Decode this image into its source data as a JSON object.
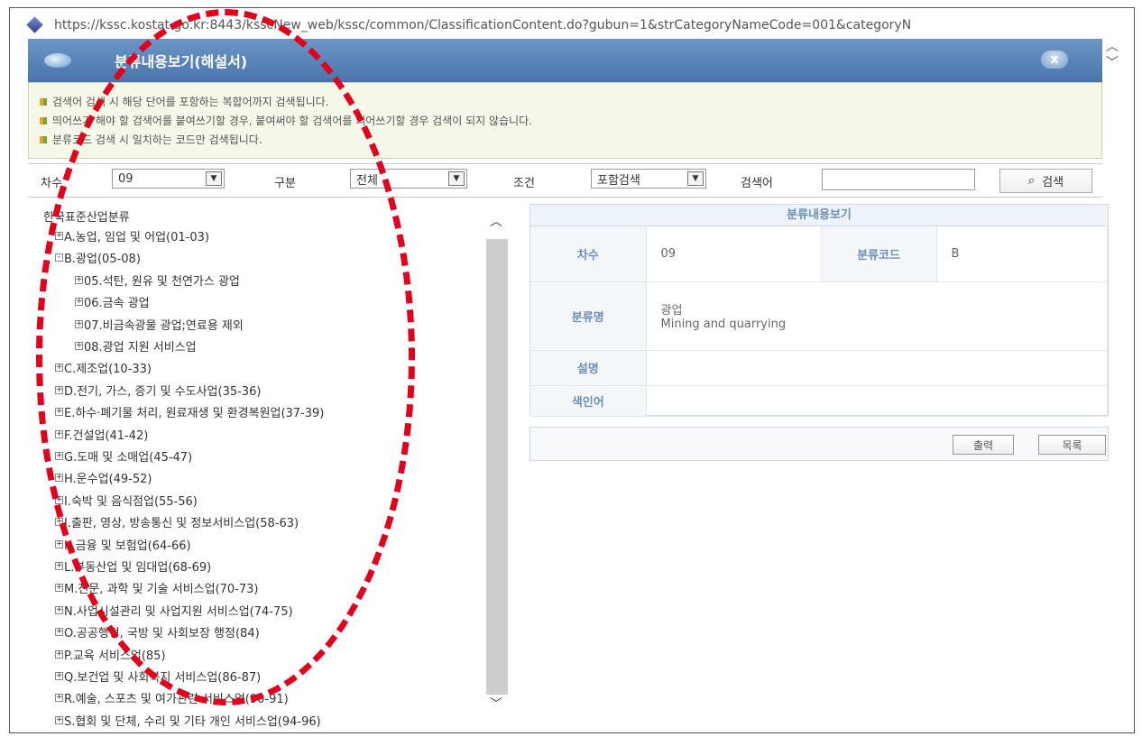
{
  "browser": {
    "url": "https://kssc.kostat.go.kr:8443/ksscNew_web/kssc/common/ClassificationContent.do?gubun=1&strCategoryNameCode=001&categoryN"
  },
  "window": {
    "title": "분류내용보기(해설서)",
    "close_label": "x"
  },
  "notice": {
    "lines": [
      "검색어 검색 시 해당 단어를 포함하는 복합어까지 검색됩니다.",
      "띄어쓰기 해야 할 검색어를 붙여쓰기할 경우, 붙여써야 할 검색어를 띄어쓰기할 경우 검색이 되지 않습니다.",
      "분류코드 검색 시 일치하는 코드만 검색됩니다."
    ]
  },
  "search": {
    "degree_label": "차수",
    "degree_value": "09",
    "division_label": "구분",
    "division_value": "전체",
    "condition_label": "조건",
    "condition_value": "포함검색",
    "keyword_label": "검색어",
    "keyword_value": "",
    "button_label": "검색",
    "icon": "search-icon"
  },
  "tree": {
    "root": "한국표준산업분류",
    "nodes": [
      {
        "label": "A.농업, 임업 및 어업(01-03)",
        "sign": "+",
        "level": 0
      },
      {
        "label": "B.광업(05-08)",
        "sign": "-",
        "level": 0
      },
      {
        "label": "05.석탄, 원유 및 천연가스 광업",
        "sign": "+",
        "level": 1
      },
      {
        "label": "06.금속 광업",
        "sign": "+",
        "level": 1
      },
      {
        "label": "07.비금속광물 광업;연료용 제외",
        "sign": "+",
        "level": 1
      },
      {
        "label": "08.광업 지원 서비스업",
        "sign": "+",
        "level": 1
      },
      {
        "label": "C.제조업(10-33)",
        "sign": "+",
        "level": 0
      },
      {
        "label": "D.전기, 가스, 증기 및 수도사업(35-36)",
        "sign": "+",
        "level": 0
      },
      {
        "label": "E.하수·폐기물 처리, 원료재생 및 환경복원업(37-39)",
        "sign": "+",
        "level": 0
      },
      {
        "label": "F.건설업(41-42)",
        "sign": "+",
        "level": 0
      },
      {
        "label": "G.도매 및 소매업(45-47)",
        "sign": "+",
        "level": 0
      },
      {
        "label": "H.운수업(49-52)",
        "sign": "+",
        "level": 0
      },
      {
        "label": "I.숙박 및 음식점업(55-56)",
        "sign": "+",
        "level": 0
      },
      {
        "label": "J.출판, 영상, 방송통신 및 정보서비스업(58-63)",
        "sign": "+",
        "level": 0
      },
      {
        "label": "K.금융 및 보험업(64-66)",
        "sign": "+",
        "level": 0
      },
      {
        "label": "L.부동산업 및 임대업(68-69)",
        "sign": "+",
        "level": 0
      },
      {
        "label": "M.전문, 과학 및 기술 서비스업(70-73)",
        "sign": "+",
        "level": 0
      },
      {
        "label": "N.사업시설관리 및 사업지원 서비스업(74-75)",
        "sign": "+",
        "level": 0
      },
      {
        "label": "O.공공행정, 국방 및 사회보장 행정(84)",
        "sign": "+",
        "level": 0
      },
      {
        "label": "P.교육 서비스업(85)",
        "sign": "+",
        "level": 0
      },
      {
        "label": "Q.보건업 및 사회복지 서비스업(86-87)",
        "sign": "+",
        "level": 0
      },
      {
        "label": "R.예술, 스포츠 및 여가관련 서비스업(90-91)",
        "sign": "+",
        "level": 0
      },
      {
        "label": "S.협회 및 단체, 수리 및 기타 개인 서비스업(94-96)",
        "sign": "+",
        "level": 0
      }
    ]
  },
  "detail": {
    "header": "분류내용보기",
    "degree_label": "차수",
    "degree_value": "09",
    "code_label": "분류코드",
    "code_value": "B",
    "name_label": "분류명",
    "name_ko": "광업",
    "name_en": "Mining and quarrying",
    "desc_label": "설명",
    "desc_value": "",
    "index_label": "색인어",
    "index_value": "",
    "print_label": "출력",
    "list_label": "목록"
  },
  "colors": {
    "annotation": "#e3001b",
    "title_bar": "#5b85b8",
    "notice_bg": "#f5f8e9"
  }
}
